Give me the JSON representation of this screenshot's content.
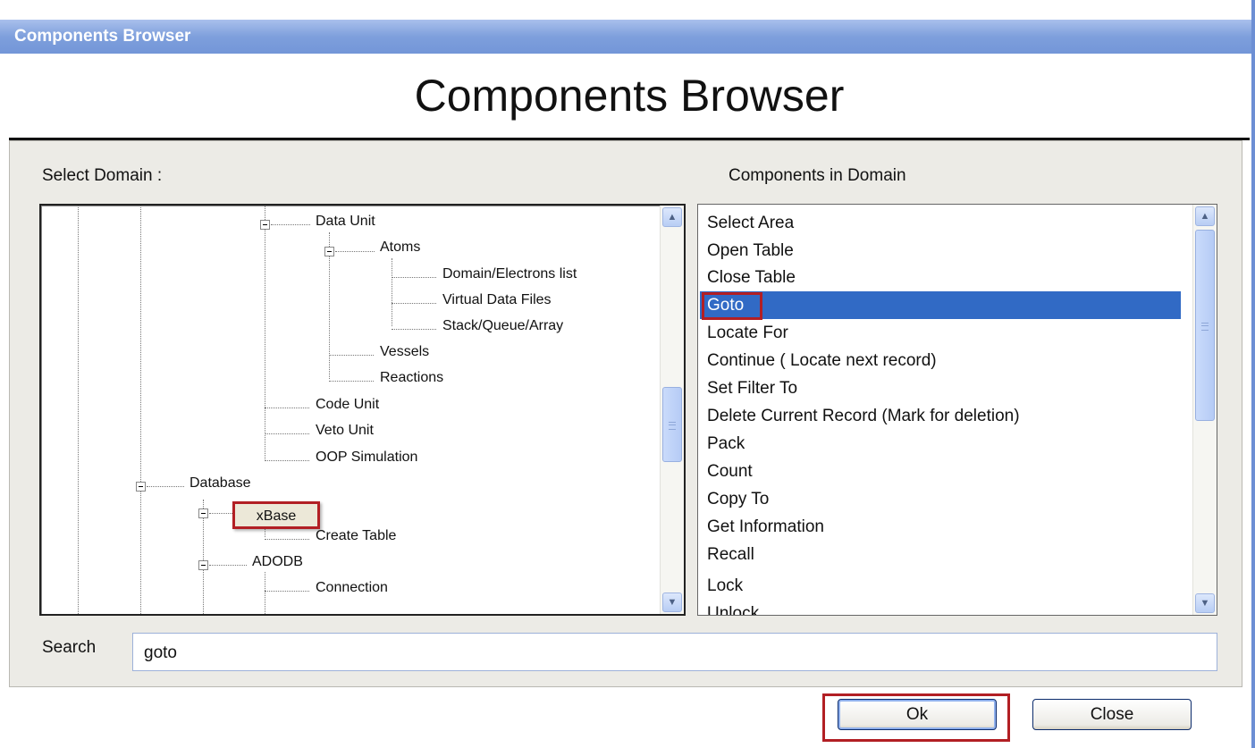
{
  "window": {
    "title": "Components Browser"
  },
  "header": {
    "title": "Components Browser"
  },
  "left_panel": {
    "label": "Select Domain :"
  },
  "right_panel": {
    "label": "Components in Domain"
  },
  "tree": {
    "nodes": [
      {
        "label": "Data Unit",
        "expandable": true
      },
      {
        "label": "Atoms",
        "expandable": true
      },
      {
        "label": "Domain/Electrons list"
      },
      {
        "label": "Virtual Data Files"
      },
      {
        "label": "Stack/Queue/Array"
      },
      {
        "label": "Vessels"
      },
      {
        "label": "Reactions"
      },
      {
        "label": "Code Unit"
      },
      {
        "label": "Veto Unit"
      },
      {
        "label": "OOP Simulation"
      },
      {
        "label": "Database",
        "expandable": true
      },
      {
        "label": "xBase",
        "expandable": true,
        "highlighted": true
      },
      {
        "label": "Create Table"
      },
      {
        "label": "ADODB",
        "expandable": true
      },
      {
        "label": "Connection"
      }
    ]
  },
  "components": {
    "items": [
      "Select Area",
      "Open Table",
      "Close Table",
      "Goto",
      "Locate For",
      "Continue ( Locate next record)",
      "Set Filter To",
      "Delete Current Record (Mark for deletion)",
      "Pack",
      "Count",
      "Copy To",
      "Get Information",
      "Recall",
      "Lock",
      "Unlock"
    ],
    "selected": "Goto"
  },
  "search": {
    "label": "Search",
    "value": "goto"
  },
  "buttons": {
    "ok": "Ok",
    "close": "Close"
  },
  "colors": {
    "selection": "#316ac5",
    "highlight_frame": "#b21f24",
    "titlebar": "#7e9fdc"
  }
}
